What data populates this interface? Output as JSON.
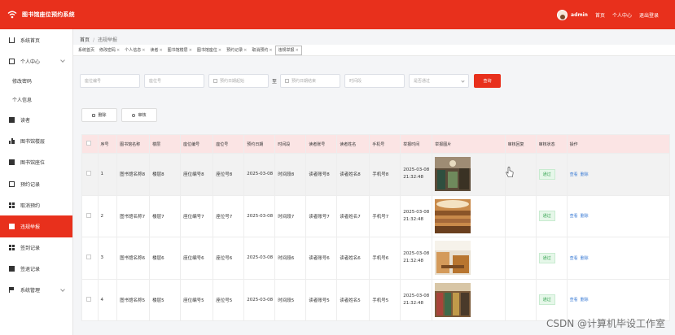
{
  "app": {
    "title": "图书馆座位预约系统"
  },
  "header": {
    "username": "admin",
    "links": [
      "首页",
      "个人中心",
      "退出登录"
    ]
  },
  "sidebar": {
    "items": [
      {
        "label": "系统首页",
        "icon": "home-icon"
      },
      {
        "label": "个人中心",
        "icon": "user-box-icon",
        "expandable": true
      },
      {
        "label": "修改密码",
        "sub": true
      },
      {
        "label": "个人信息",
        "sub": true
      },
      {
        "label": "读者",
        "icon": "square-icon"
      },
      {
        "label": "图书馆楼层",
        "icon": "bar-icon"
      },
      {
        "label": "图书馆座位",
        "icon": "square-icon"
      },
      {
        "label": "预约记录",
        "icon": "box-icon"
      },
      {
        "label": "取消预约",
        "icon": "grid-icon"
      },
      {
        "label": "违规举报",
        "icon": "square-icon",
        "active": true
      },
      {
        "label": "签到记录",
        "icon": "grid-icon"
      },
      {
        "label": "签退记录",
        "icon": "square-icon"
      },
      {
        "label": "系统管理",
        "icon": "flag-icon",
        "expandable": true
      }
    ]
  },
  "breadcrumb": {
    "home": "首页",
    "current": "违规举报"
  },
  "tabs": [
    {
      "label": "系统首页",
      "closable": false
    },
    {
      "label": "修改密码",
      "closable": true
    },
    {
      "label": "个人信息",
      "closable": true
    },
    {
      "label": "读者",
      "closable": true
    },
    {
      "label": "图书馆楼层",
      "closable": true
    },
    {
      "label": "图书馆座位",
      "closable": true
    },
    {
      "label": "预约记录",
      "closable": true
    },
    {
      "label": "取消预约",
      "closable": true
    },
    {
      "label": "违规举报",
      "closable": true,
      "active": true
    }
  ],
  "filters": {
    "seat_code": "座位编号",
    "seat_no": "座位号",
    "date_start": "预约日期起始",
    "to": "至",
    "date_end": "预约日期结束",
    "period": "时间段",
    "approved": "是否通过",
    "search_label": "查询"
  },
  "actions": {
    "delete_label": "删除",
    "review_label": "审核"
  },
  "table": {
    "columns": [
      "",
      "序号",
      "图书馆名称",
      "楼层",
      "座位编号",
      "座位号",
      "预约日期",
      "时间段",
      "读者账号",
      "读者姓名",
      "手机号",
      "举报时间",
      "举报图片",
      "审核回复",
      "审核状态",
      "操作"
    ],
    "rows": [
      {
        "no": "1",
        "library": "图书馆名称8",
        "floor": "楼层8",
        "seat_code": "座位编号8",
        "seat_no": "座位号8",
        "date": "2025-03-08",
        "period": "时间段8",
        "account": "读者账号8",
        "name": "读者姓名8",
        "phone": "手机号8",
        "time_date": "2025-03-08",
        "time_clock": "21:32:48",
        "reply": "",
        "status": "通过",
        "view": "查看",
        "delete": "删除"
      },
      {
        "no": "2",
        "library": "图书馆名称7",
        "floor": "楼层7",
        "seat_code": "座位编号7",
        "seat_no": "座位号7",
        "date": "2025-03-08",
        "period": "时间段7",
        "account": "读者账号7",
        "name": "读者姓名7",
        "phone": "手机号7",
        "time_date": "2025-03-08",
        "time_clock": "21:32:48",
        "reply": "",
        "status": "通过",
        "view": "查看",
        "delete": "删除"
      },
      {
        "no": "3",
        "library": "图书馆名称6",
        "floor": "楼层6",
        "seat_code": "座位编号6",
        "seat_no": "座位号6",
        "date": "2025-03-08",
        "period": "时间段6",
        "account": "读者账号6",
        "name": "读者姓名6",
        "phone": "手机号6",
        "time_date": "2025-03-08",
        "time_clock": "21:32:48",
        "reply": "",
        "status": "通过",
        "view": "查看",
        "delete": "删除"
      },
      {
        "no": "4",
        "library": "图书馆名称5",
        "floor": "楼层5",
        "seat_code": "座位编号5",
        "seat_no": "座位号5",
        "date": "2025-03-08",
        "period": "时间段5",
        "account": "读者账号5",
        "name": "读者姓名5",
        "phone": "手机号5",
        "time_date": "2025-03-08",
        "time_clock": "21:32:48",
        "reply": "",
        "status": "通过",
        "view": "查看",
        "delete": "删除"
      }
    ]
  },
  "watermark": "CSDN @计算机毕设工作室",
  "colors": {
    "accent": "#e8301c",
    "header_row": "#fbe4e4",
    "status_green": "#3aa655",
    "link_blue": "#3a7bd5"
  }
}
